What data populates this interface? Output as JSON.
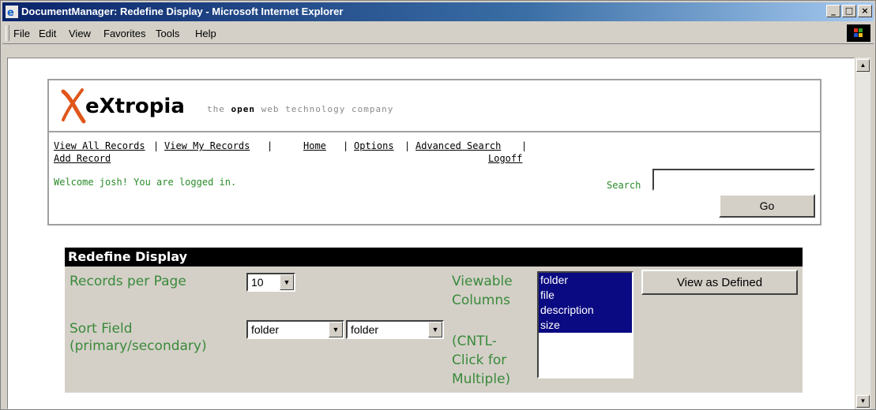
{
  "window": {
    "title": "DocumentManager: Redefine Display - Microsoft Internet Explorer",
    "controls": [
      "_",
      "□",
      "×"
    ]
  },
  "menu": [
    "File",
    "Edit",
    "View",
    "Favorites",
    "Tools",
    "Help"
  ],
  "logo": {
    "wordmark": "eXtropia",
    "tagline_pre": "the ",
    "tagline_bold": "open",
    "tagline_post": " web technology company"
  },
  "nav": {
    "view_all": "View All Records",
    "view_my": "View My Records",
    "add_record": "Add Record",
    "home": "Home",
    "options": "Options",
    "advanced_search": "Advanced Search",
    "logoff": "Logoff",
    "separator": "|"
  },
  "welcome": "Welcome josh! You are logged in.",
  "search": {
    "label": "Search",
    "value": "",
    "button": "Go"
  },
  "redefine": {
    "heading": "Redefine Display",
    "records_per_page_label": "Records per Page",
    "records_per_page_value": "10",
    "sort_label_1": "Sort Field",
    "sort_label_2": "(primary/secondary)",
    "primary_sort": "folder",
    "secondary_sort": "folder",
    "viewable_label_1": "Viewable",
    "viewable_label_2": "Columns",
    "hint_1": "(CNTL-",
    "hint_2": "Click for",
    "hint_3": "Multiple)",
    "columns": [
      "folder",
      "file",
      "description",
      "size"
    ],
    "view_button": "View as Defined"
  },
  "colors": {
    "titlebar": "#0a246a",
    "label_green": "#3a8a3a",
    "selection": "#0a0a82"
  }
}
